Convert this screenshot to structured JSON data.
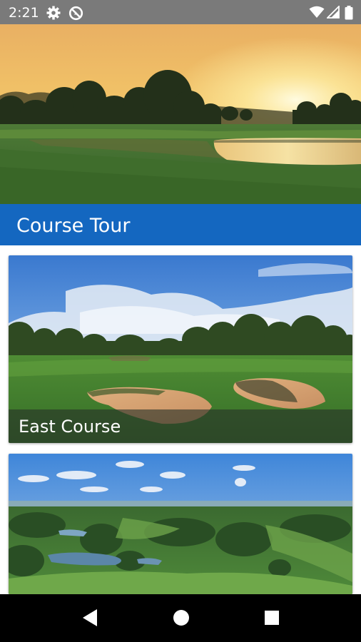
{
  "status_bar": {
    "time": "2:21",
    "icons": [
      "gear-icon",
      "do-not-disturb-icon",
      "wifi-icon",
      "signal-icon",
      "battery-icon"
    ]
  },
  "hero": {
    "image": "golf-course-sunset-lake"
  },
  "header": {
    "title": "Course Tour",
    "color": "#1467c0"
  },
  "courses": [
    {
      "name": "East Course",
      "image": "fairway-with-bunkers"
    },
    {
      "name": "",
      "image": "aerial-course-view"
    }
  ],
  "nav_bar": {
    "icons": [
      "back-icon",
      "home-icon",
      "recents-icon"
    ]
  }
}
